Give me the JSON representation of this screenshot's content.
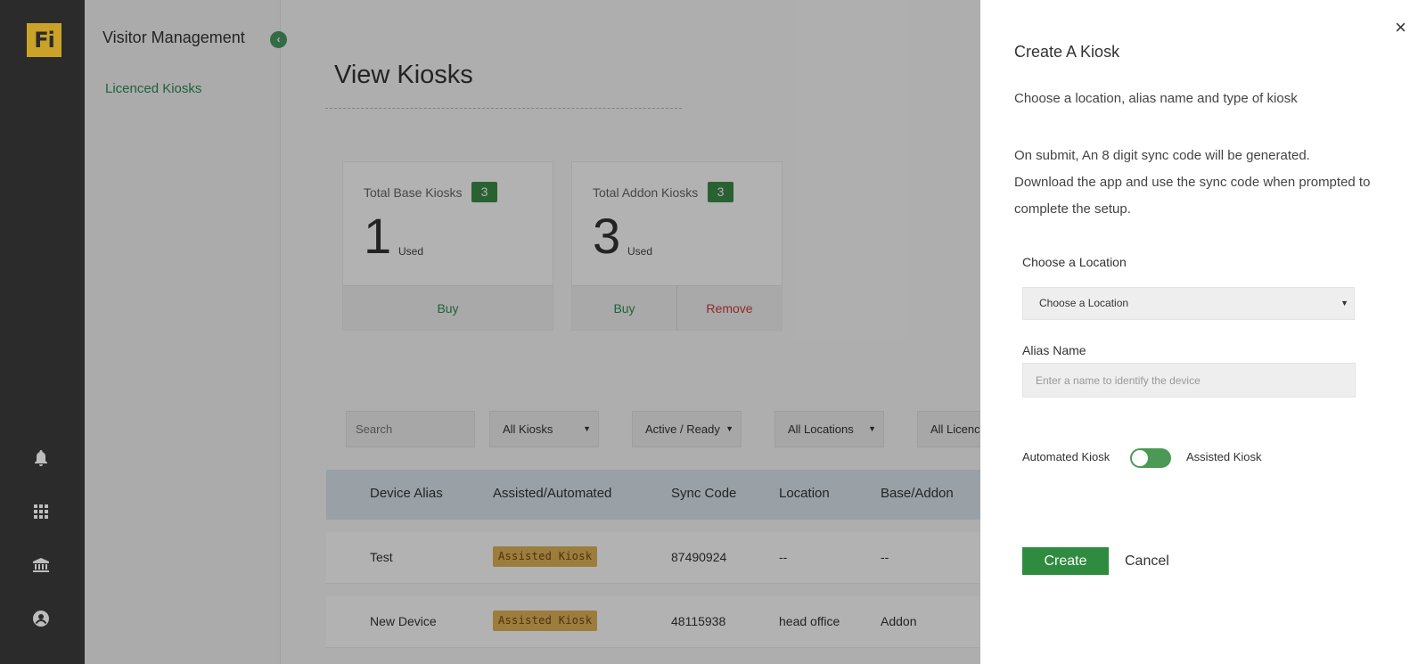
{
  "rail": {
    "logo_text": "Fi",
    "icons": [
      "bell-icon",
      "apps-grid-icon",
      "building-icon",
      "account-icon"
    ]
  },
  "subnav": {
    "title": "Visitor Management",
    "items": [
      {
        "label": "Licenced Kiosks"
      }
    ]
  },
  "main": {
    "title": "View Kiosks",
    "cards": [
      {
        "label": "Total Base Kiosks",
        "badge": "3",
        "value": "1",
        "used": "Used",
        "actions": [
          "Buy"
        ]
      },
      {
        "label": "Total Addon Kiosks",
        "badge": "3",
        "value": "3",
        "used": "Used",
        "actions": [
          "Buy",
          "Remove"
        ]
      }
    ],
    "filters": {
      "search_placeholder": "Search",
      "kiosk_type": "All Kiosks",
      "status": "Active / Ready",
      "location": "All Locations",
      "licence": "All Licences"
    },
    "table": {
      "headers": [
        "Device Alias",
        "Assisted/Automated",
        "Sync Code",
        "Location",
        "Base/Addon"
      ],
      "rows": [
        {
          "alias": "Test",
          "type": "Assisted Kiosk",
          "sync_code": "87490924",
          "location": "--",
          "base_addon": "--"
        },
        {
          "alias": "New Device",
          "type": "Assisted Kiosk",
          "sync_code": "48115938",
          "location": "head office",
          "base_addon": "Addon"
        }
      ]
    }
  },
  "drawer": {
    "title": "Create A Kiosk",
    "subtitle": "Choose a location, alias name and type of kiosk",
    "info_line1": "On submit, An 8 digit sync code will be generated.",
    "info_line2": "Download the app and use the sync code when prompted to complete the setup.",
    "location_label": "Choose a Location",
    "location_value": "Choose a Location",
    "alias_label": "Alias Name",
    "alias_placeholder": "Enter a name to identify the device",
    "toggle_left": "Automated Kiosk",
    "toggle_right": "Assisted Kiosk",
    "create_label": "Create",
    "cancel_label": "Cancel",
    "close_glyph": "×"
  },
  "colors": {
    "accent_green": "#2e8b3f",
    "badge_green": "#3d8b4a",
    "remove_red": "#d23c3c",
    "pill_amber": "#e0b458",
    "rail_dark": "#2b2b2b"
  }
}
